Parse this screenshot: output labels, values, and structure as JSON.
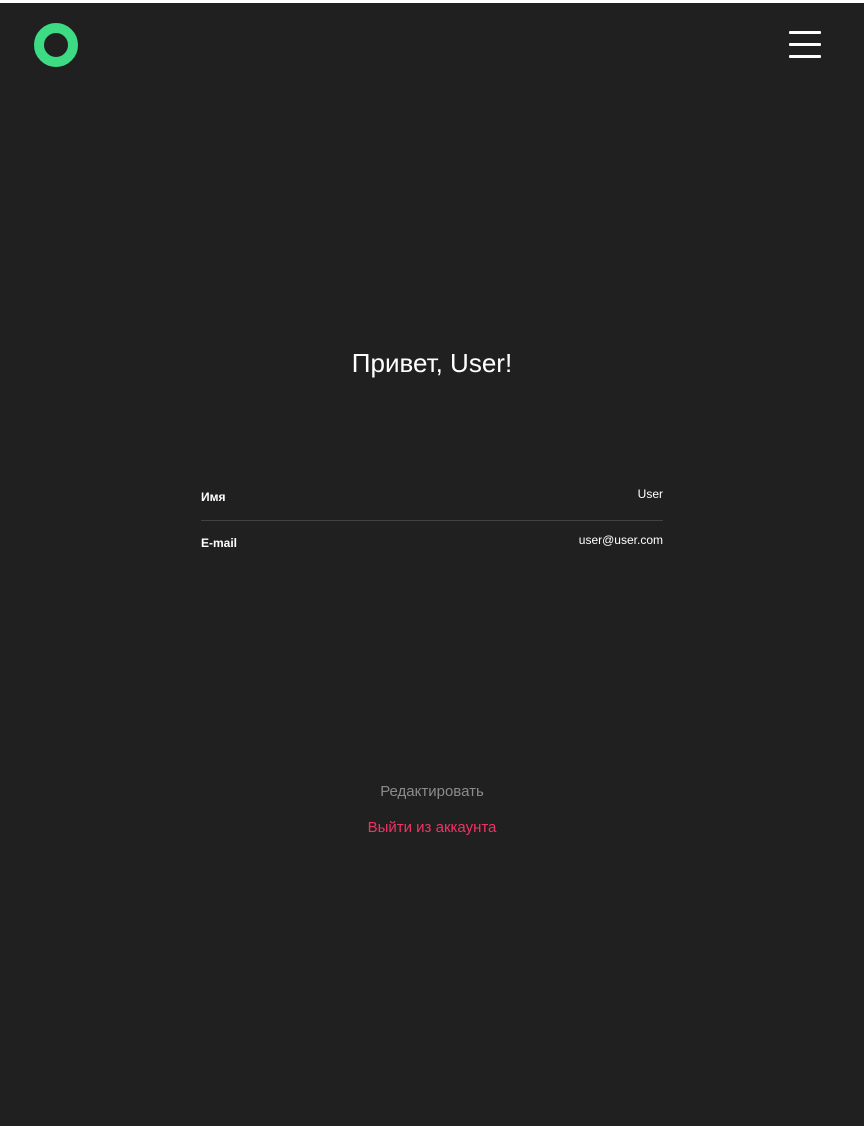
{
  "header": {
    "logo_icon": "ring-logo-icon",
    "logo_color": "#3ddc84",
    "menu_icon": "hamburger-menu-icon"
  },
  "profile": {
    "greeting": "Привет, User!",
    "fields": [
      {
        "label": "Имя",
        "value": "User"
      },
      {
        "label": "E-mail",
        "value": "user@user.com"
      }
    ]
  },
  "actions": {
    "edit_label": "Редактировать",
    "logout_label": "Выйти из аккаунта",
    "logout_color": "#ee3465"
  },
  "colors": {
    "background": "#202020",
    "text": "#ffffff",
    "muted": "#8b8b8b",
    "divider": "#424242"
  }
}
